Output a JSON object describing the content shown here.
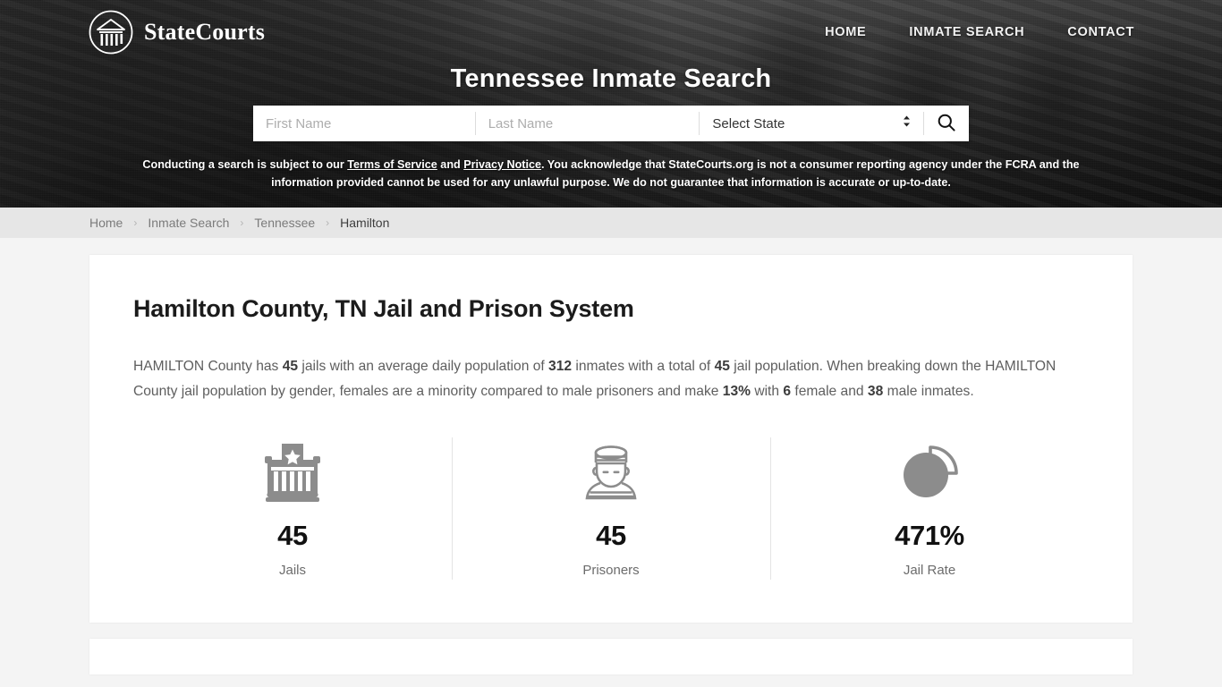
{
  "header": {
    "brand_name": "StateCourts",
    "brand_icon": "courthouse-logo-icon",
    "nav": [
      {
        "label": "HOME",
        "name": "nav-home"
      },
      {
        "label": "INMATE SEARCH",
        "name": "nav-inmate-search"
      },
      {
        "label": "CONTACT",
        "name": "nav-contact"
      }
    ],
    "hero_title": "Tennessee Inmate Search"
  },
  "search": {
    "first_name_placeholder": "First Name",
    "first_name_value": "",
    "last_name_placeholder": "Last Name",
    "last_name_value": "",
    "state_selected": "Select State",
    "state_options": [
      "Select State"
    ],
    "search_icon": "search-icon",
    "spinner_icon": "chevron-updown-icon"
  },
  "disclaimer": {
    "part1": "Conducting a search is subject to our ",
    "link1": "Terms of Service",
    "part2": " and ",
    "link2": "Privacy Notice",
    "part3": ". You acknowledge that StateCourts.org is not a consumer reporting agency under the FCRA and the information provided cannot be used for any unlawful purpose. We do not guarantee that information is accurate or up-to-date."
  },
  "breadcrumb": {
    "separator": "›",
    "items": [
      {
        "label": "Home",
        "current": false
      },
      {
        "label": "Inmate Search",
        "current": false
      },
      {
        "label": "Tennessee",
        "current": false
      },
      {
        "label": "Hamilton",
        "current": true
      }
    ]
  },
  "main": {
    "title": "Hamilton County, TN Jail and Prison System",
    "intro": {
      "s1": "HAMILTON County has ",
      "b1": "45",
      "s2": " jails with an average daily population of ",
      "b2": "312",
      "s3": " inmates with a total of ",
      "b3": "45",
      "s4": " jail population. When breaking down the HAMILTON County jail population by gender, females are a minority compared to male prisoners and make ",
      "b4": "13%",
      "s5": " with ",
      "b5": "6",
      "s6": " female and ",
      "b6": "38",
      "s7": " male inmates."
    },
    "stats": [
      {
        "value": "45",
        "label": "Jails",
        "icon": "jail-building-icon"
      },
      {
        "value": "45",
        "label": "Prisoners",
        "icon": "prisoner-icon"
      },
      {
        "value": "471%",
        "label": "Jail Rate",
        "icon": "pie-chart-icon"
      }
    ]
  },
  "colors": {
    "page_bg": "#f4f4f4",
    "card_bg": "#ffffff",
    "breadcrumb_bg": "#e6e6e6",
    "icon_gray": "#8c8c8c",
    "text_dark": "#111111",
    "text_muted": "#6c6c6c"
  }
}
